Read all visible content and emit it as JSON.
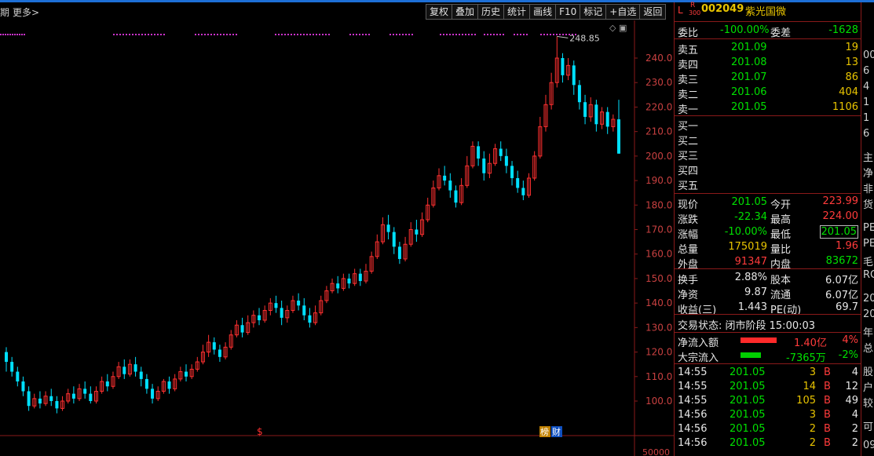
{
  "topbar": {
    "period": "期",
    "more": "更多",
    "buttons": [
      "复权",
      "叠加",
      "历史",
      "统计",
      "画线",
      "F10",
      "标记",
      "+自选",
      "返回"
    ]
  },
  "stock": {
    "badge_l": "L",
    "badge_r": "R",
    "badge_r_sub": "300",
    "code": "002049",
    "name": "紫光国微"
  },
  "chart": {
    "y_ticks": [
      "240.0",
      "230.0",
      "220.0",
      "210.0",
      "200.0",
      "190.0",
      "180.0",
      "170.0",
      "160.0",
      "150.0",
      "140.0",
      "130.0",
      "120.0",
      "110.0",
      "100.0"
    ],
    "high_label": "248.85",
    "bottom_label": "50000",
    "marker_s": "$",
    "marker_bang": "榜",
    "marker_cai": "财",
    "colors": {
      "up": "#ff3030",
      "down": "#00e0ff",
      "dots": "#cc33cc"
    }
  },
  "chart_data": {
    "type": "candlestick",
    "ylim": [
      95,
      250
    ],
    "y_ticks": [
      240,
      230,
      220,
      210,
      200,
      190,
      180,
      170,
      160,
      150,
      140,
      130,
      120,
      110,
      100
    ],
    "high_annotation": 248.85,
    "candles": [
      [
        120,
        116,
        122,
        112
      ],
      [
        116,
        112,
        118,
        110
      ],
      [
        112,
        108,
        114,
        106
      ],
      [
        108,
        104,
        110,
        102
      ],
      [
        104,
        98,
        106,
        96
      ],
      [
        98,
        101,
        103,
        97
      ],
      [
        101,
        99,
        104,
        97
      ],
      [
        99,
        102,
        104,
        98
      ],
      [
        102,
        100,
        105,
        98
      ],
      [
        100,
        97,
        102,
        95
      ],
      [
        97,
        100,
        102,
        96
      ],
      [
        100,
        103,
        105,
        99
      ],
      [
        103,
        101,
        106,
        99
      ],
      [
        101,
        105,
        107,
        100
      ],
      [
        105,
        103,
        108,
        101
      ],
      [
        103,
        100,
        106,
        99
      ],
      [
        100,
        104,
        106,
        99
      ],
      [
        104,
        108,
        110,
        103
      ],
      [
        108,
        106,
        111,
        104
      ],
      [
        106,
        110,
        112,
        105
      ],
      [
        110,
        114,
        116,
        109
      ],
      [
        114,
        111,
        117,
        109
      ],
      [
        111,
        115,
        117,
        110
      ],
      [
        115,
        112,
        118,
        110
      ],
      [
        112,
        109,
        114,
        106
      ],
      [
        109,
        105,
        111,
        103
      ],
      [
        105,
        101,
        107,
        99
      ],
      [
        101,
        104,
        106,
        100
      ],
      [
        104,
        108,
        109,
        103
      ],
      [
        108,
        105,
        110,
        103
      ],
      [
        105,
        109,
        111,
        104
      ],
      [
        109,
        112,
        114,
        108
      ],
      [
        112,
        110,
        115,
        108
      ],
      [
        110,
        113,
        115,
        109
      ],
      [
        113,
        116,
        118,
        112
      ],
      [
        116,
        120,
        123,
        115
      ],
      [
        120,
        124,
        127,
        118
      ],
      [
        124,
        121,
        126,
        119
      ],
      [
        121,
        118,
        123,
        116
      ],
      [
        118,
        122,
        124,
        117
      ],
      [
        122,
        127,
        129,
        121
      ],
      [
        127,
        131,
        133,
        126
      ],
      [
        131,
        128,
        134,
        126
      ],
      [
        128,
        132,
        135,
        127
      ],
      [
        132,
        135,
        137,
        130
      ],
      [
        135,
        133,
        138,
        131
      ],
      [
        133,
        137,
        139,
        132
      ],
      [
        137,
        140,
        142,
        135
      ],
      [
        140,
        138,
        143,
        136
      ],
      [
        138,
        134,
        141,
        131
      ],
      [
        134,
        137,
        139,
        132
      ],
      [
        137,
        141,
        143,
        136
      ],
      [
        141,
        139,
        144,
        137
      ],
      [
        139,
        135,
        142,
        133
      ],
      [
        135,
        132,
        138,
        130
      ],
      [
        132,
        136,
        139,
        131
      ],
      [
        136,
        141,
        143,
        135
      ],
      [
        141,
        145,
        147,
        140
      ],
      [
        145,
        148,
        150,
        144
      ],
      [
        148,
        146,
        151,
        144
      ],
      [
        146,
        150,
        152,
        145
      ],
      [
        150,
        148,
        152,
        146
      ],
      [
        148,
        152,
        154,
        147
      ],
      [
        152,
        149,
        154,
        147
      ],
      [
        149,
        153,
        156,
        148
      ],
      [
        153,
        159,
        161,
        152
      ],
      [
        159,
        165,
        168,
        158
      ],
      [
        165,
        172,
        175,
        164
      ],
      [
        172,
        169,
        176,
        166
      ],
      [
        169,
        163,
        171,
        160
      ],
      [
        163,
        158,
        165,
        156
      ],
      [
        158,
        164,
        167,
        157
      ],
      [
        164,
        170,
        173,
        163
      ],
      [
        170,
        168,
        174,
        165
      ],
      [
        168,
        174,
        177,
        167
      ],
      [
        174,
        180,
        183,
        173
      ],
      [
        180,
        187,
        190,
        179
      ],
      [
        187,
        192,
        195,
        186
      ],
      [
        192,
        190,
        196,
        188
      ],
      [
        190,
        186,
        193,
        183
      ],
      [
        186,
        181,
        188,
        179
      ],
      [
        181,
        188,
        191,
        180
      ],
      [
        188,
        196,
        200,
        187
      ],
      [
        196,
        204,
        206,
        195
      ],
      [
        204,
        199,
        206,
        196
      ],
      [
        199,
        193,
        202,
        190
      ],
      [
        193,
        197,
        201,
        191
      ],
      [
        197,
        203,
        205,
        196
      ],
      [
        203,
        200,
        206,
        198
      ],
      [
        200,
        196,
        203,
        193
      ],
      [
        196,
        191,
        198,
        188
      ],
      [
        191,
        187,
        194,
        185
      ],
      [
        187,
        184,
        190,
        182
      ],
      [
        184,
        191,
        193,
        183
      ],
      [
        191,
        200,
        202,
        190
      ],
      [
        200,
        212,
        216,
        199
      ],
      [
        212,
        221,
        225,
        210
      ],
      [
        221,
        230,
        234,
        219
      ],
      [
        230,
        240,
        248.85,
        228
      ],
      [
        240,
        233,
        242,
        230
      ],
      [
        233,
        237,
        240,
        231
      ],
      [
        237,
        229,
        239,
        225
      ],
      [
        229,
        222,
        231,
        219
      ],
      [
        222,
        216,
        225,
        213
      ],
      [
        216,
        221,
        224,
        214
      ],
      [
        221,
        213,
        223,
        210
      ],
      [
        213,
        218,
        220,
        211
      ],
      [
        218,
        212,
        220,
        209
      ],
      [
        212,
        215,
        217,
        210
      ],
      [
        215,
        201,
        223,
        201
      ]
    ]
  },
  "panel": {
    "ratio": {
      "label": "委比",
      "value": "-100.00%",
      "label2": "委差",
      "value2": "-1628"
    },
    "asks": [
      {
        "label": "卖五",
        "price": "201.09",
        "vol": "19"
      },
      {
        "label": "卖四",
        "price": "201.08",
        "vol": "13"
      },
      {
        "label": "卖三",
        "price": "201.07",
        "vol": "86"
      },
      {
        "label": "卖二",
        "price": "201.06",
        "vol": "404"
      },
      {
        "label": "卖一",
        "price": "201.05",
        "vol": "1106"
      }
    ],
    "bids": [
      "买一",
      "买二",
      "买三",
      "买四",
      "买五"
    ],
    "stats": [
      {
        "l1": "现价",
        "v1": "201.05",
        "l2": "今开",
        "v2": "223.99"
      },
      {
        "l1": "涨跌",
        "v1": "-22.34",
        "l2": "最高",
        "v2": "224.00"
      },
      {
        "l1": "涨幅",
        "v1": "-10.00%",
        "l2": "最低",
        "v2": "201.05"
      },
      {
        "l1": "总量",
        "v1": "175019",
        "l2": "量比",
        "v2": "1.96"
      },
      {
        "l1": "外盘",
        "v1": "91347",
        "l2": "内盘",
        "v2": "83672"
      }
    ],
    "fund": [
      {
        "l1": "换手",
        "v1": "2.88%",
        "l2": "股本",
        "v2": "6.07亿"
      },
      {
        "l1": "净资",
        "v1": "9.87",
        "l2": "流通",
        "v2": "6.07亿"
      },
      {
        "l1": "收益(三)",
        "v1": "1.443",
        "l2": "PE(动)",
        "v2": "69.7"
      }
    ],
    "trade_status": "交易状态: 闭市阶段 15:00:03",
    "net_inflow": {
      "label": "净流入额",
      "value": "1.40亿",
      "pct": "4%"
    },
    "block": {
      "label": "大宗流入",
      "value": "-7365万",
      "pct": "-2%"
    },
    "ticks": [
      {
        "time": "14:55",
        "price": "201.05",
        "vol": "3",
        "side": "B",
        "n": "4"
      },
      {
        "time": "14:55",
        "price": "201.05",
        "vol": "14",
        "side": "B",
        "n": "12"
      },
      {
        "time": "14:55",
        "price": "201.05",
        "vol": "105",
        "side": "B",
        "n": "49"
      },
      {
        "time": "14:56",
        "price": "201.05",
        "vol": "3",
        "side": "B",
        "n": "4"
      },
      {
        "time": "14:56",
        "price": "201.05",
        "vol": "2",
        "side": "B",
        "n": "2"
      },
      {
        "time": "14:56",
        "price": "201.05",
        "vol": "2",
        "side": "B",
        "n": "2"
      }
    ]
  },
  "right_strip": [
    "00",
    "6",
    "4",
    "1",
    "1",
    "6",
    "主",
    "净",
    "非",
    "货",
    "PE",
    "PE",
    "毛",
    "RO",
    "20",
    "20",
    "年",
    "总",
    "股",
    "户",
    "较",
    "可",
    "09"
  ]
}
